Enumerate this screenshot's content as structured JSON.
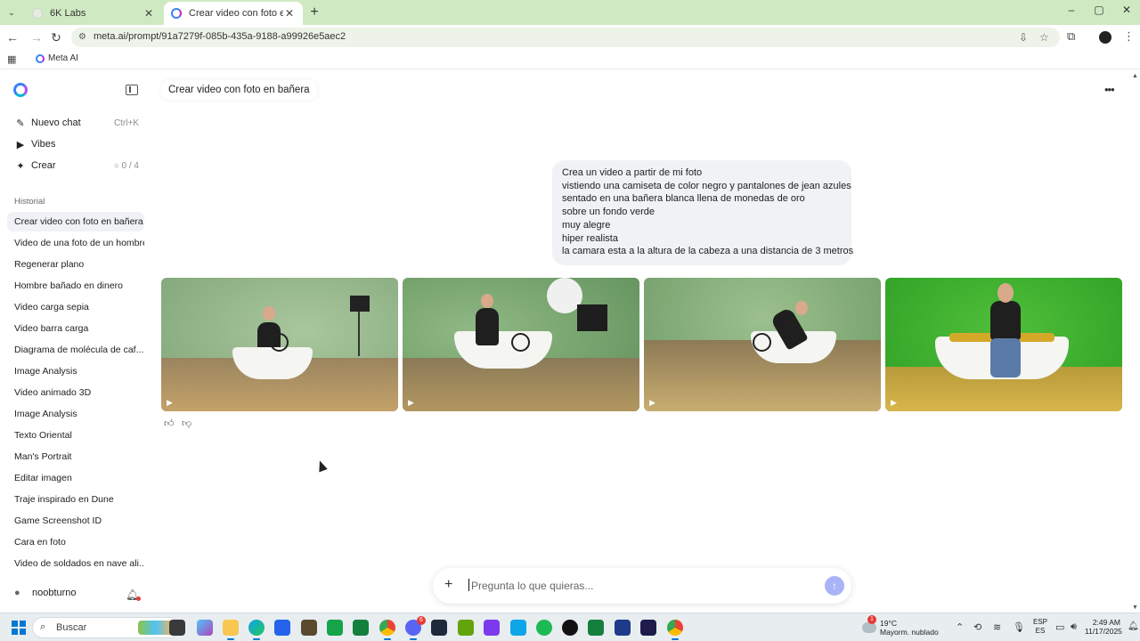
{
  "browser": {
    "tabs": [
      {
        "title": "6K Labs",
        "active": false
      },
      {
        "title": "Crear video con foto en bañera",
        "active": true
      }
    ],
    "new_tab": "+",
    "url": "meta.ai/prompt/91a7279f-085b-435a-9188-a99926e5aec2",
    "bookmarks": [
      {
        "label": "Meta AI"
      }
    ],
    "window_controls": {
      "minimize": "–",
      "maximize": "▢",
      "close": "✕"
    }
  },
  "sidebar": {
    "nav": [
      {
        "label": "Nuevo chat",
        "shortcut": "Ctrl+K",
        "icon": "edit-icon"
      },
      {
        "label": "Vibes",
        "shortcut": "",
        "icon": "play-square-icon"
      },
      {
        "label": "Crear",
        "shortcut": "0 / 4",
        "icon": "sparkle-icon"
      }
    ],
    "history_heading": "Historial",
    "history": [
      "Crear video con foto en bañera",
      "Video de una foto de un hombre",
      "Regenerar plano",
      "Hombre bañado en dinero",
      "Video carga sepia",
      "Video barra carga",
      "Diagrama de molécula de caf...",
      "Image Analysis",
      "Video animado 3D",
      "Image Analysis",
      "Texto Oriental",
      "Man's Portrait",
      "Editar imagen",
      "Traje inspirado en Dune",
      "Game Screenshot ID",
      "Cara en foto",
      "Video de soldados en nave ali..."
    ],
    "user": {
      "name": "noobturno"
    }
  },
  "main": {
    "chat_title": "Crear video con foto en bañera",
    "prompt_lines": [
      "Crea un video a partir de mi foto",
      "vistiendo una camiseta de color negro y pantalones de jean azules",
      "sentado en una bañera blanca llena de monedas de oro",
      "sobre un fondo verde",
      "muy alegre",
      "hiper realista",
      "la camara esta a la altura de la cabeza a una distancia de 3 metros"
    ],
    "videos": [
      {
        "label": "video-1",
        "loading": true
      },
      {
        "label": "video-2",
        "loading": true
      },
      {
        "label": "video-3",
        "loading": true
      },
      {
        "label": "video-4",
        "loading": false
      }
    ],
    "composer": {
      "placeholder": "Pregunta lo que quieras..."
    }
  },
  "taskbar": {
    "search_placeholder": "Buscar",
    "weather": {
      "temp": "19°C",
      "desc": "Mayorm. nublado",
      "alerts": "1"
    },
    "discord_badge": "6",
    "lang": {
      "line1": "ESP",
      "line2": "ES"
    },
    "clock": {
      "time": "2:49 AM",
      "date": "11/17/2025"
    }
  }
}
